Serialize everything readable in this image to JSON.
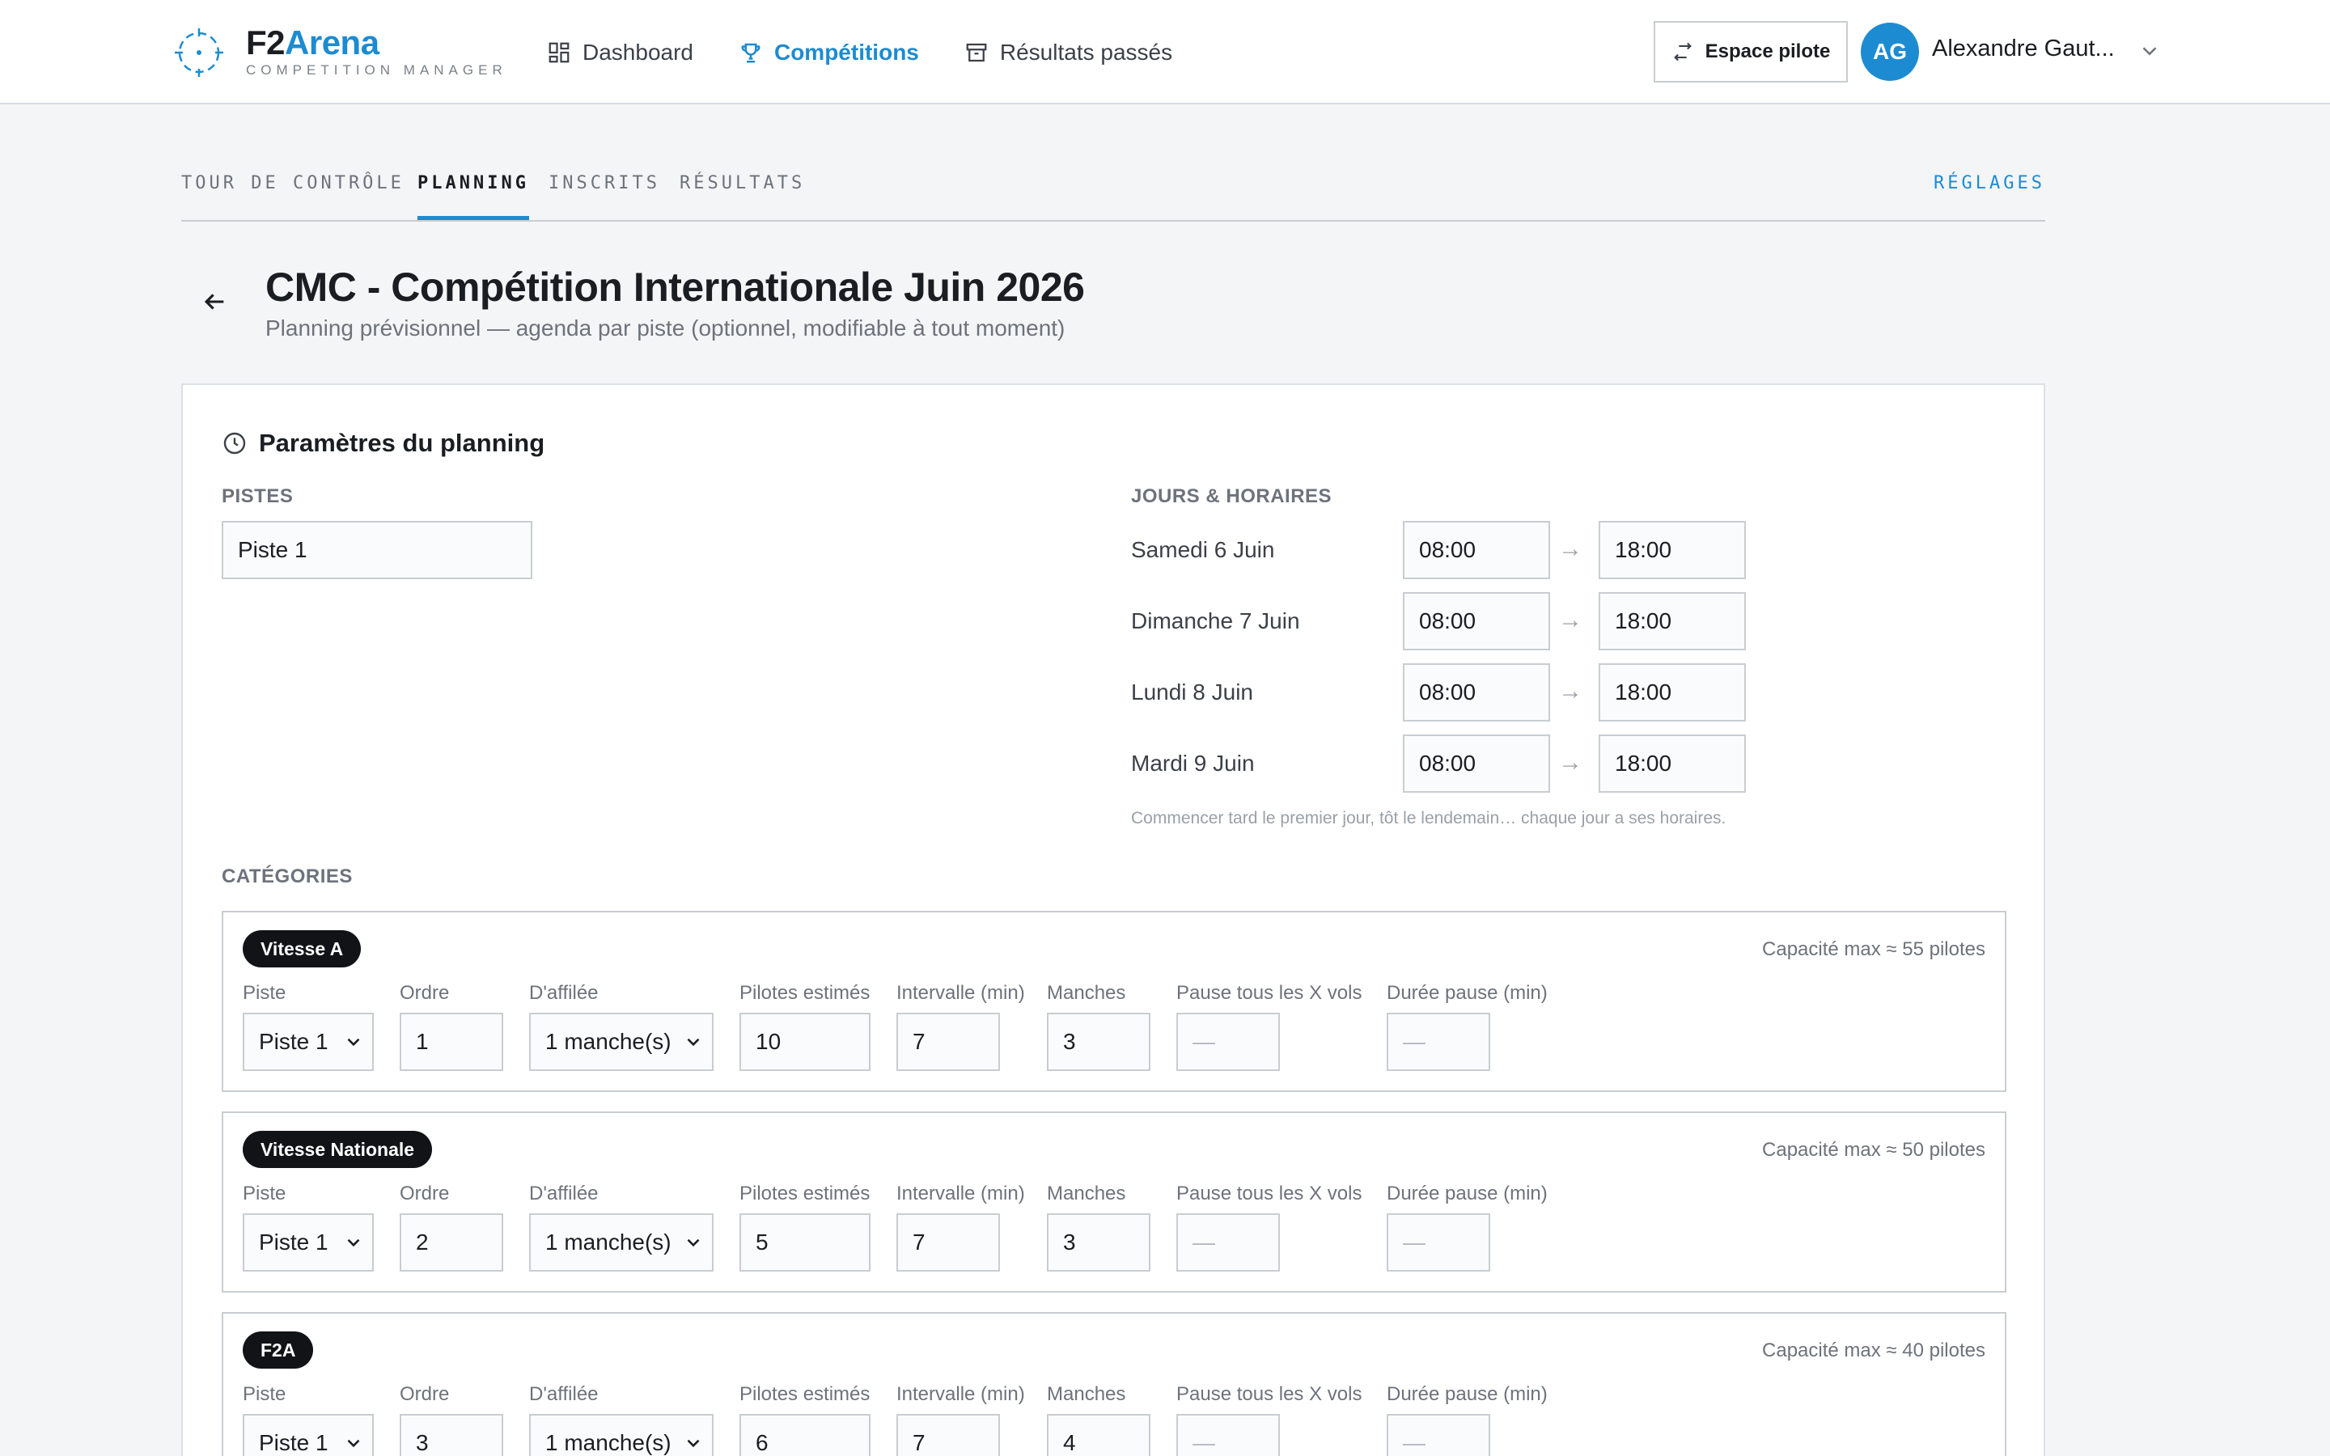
{
  "brand": {
    "name_part1": "F2",
    "name_part2": "Arena",
    "tagline": "COMPETITION MANAGER"
  },
  "nav": {
    "items": [
      {
        "label": "Dashboard",
        "icon": "grid-icon",
        "active": false
      },
      {
        "label": "Compétitions",
        "icon": "trophy-icon",
        "active": true
      },
      {
        "label": "Résultats passés",
        "icon": "archive-icon",
        "active": false
      }
    ],
    "pilot_button": "Espace pilote",
    "user": {
      "initials": "AG",
      "name": "Alexandre Gaut..."
    }
  },
  "subtabs": {
    "items": [
      "TOUR DE CONTRÔLE",
      "PLANNING",
      "INSCRITS",
      "RÉSULTATS"
    ],
    "active": "PLANNING",
    "settings": "RÉGLAGES"
  },
  "page": {
    "title": "CMC - Compétition Internationale Juin 2026",
    "subtitle": "Planning prévisionnel — agenda par piste (optionnel, modifiable à tout moment)"
  },
  "params": {
    "heading": "Paramètres du planning",
    "pistes_label": "PISTES",
    "pistes": [
      "Piste 1"
    ],
    "days_label": "JOURS & HORAIRES",
    "days": [
      {
        "label": "Samedi 6 Juin",
        "start": "08:00",
        "end": "18:00"
      },
      {
        "label": "Dimanche 7 Juin",
        "start": "08:00",
        "end": "18:00"
      },
      {
        "label": "Lundi 8 Juin",
        "start": "08:00",
        "end": "18:00"
      },
      {
        "label": "Mardi 9 Juin",
        "start": "08:00",
        "end": "18:00"
      }
    ],
    "arrow": "→",
    "hint": "Commencer tard le premier jour, tôt le lendemain… chaque jour a ses horaires."
  },
  "categories": {
    "label": "CATÉGORIES",
    "field_labels": {
      "piste": "Piste",
      "ordre": "Ordre",
      "affilee": "D'affilée",
      "pilotes": "Pilotes estimés",
      "intervalle": "Intervalle (min)",
      "manches": "Manches",
      "pause_vols": "Pause tous les X vols",
      "pause_duree": "Durée pause (min)"
    },
    "items": [
      {
        "name": "Vitesse A",
        "capacity": "Capacité max ≈ 55 pilotes",
        "piste": "Piste 1",
        "ordre": "1",
        "affilee": "1 manche(s)",
        "pilotes": "10",
        "intervalle": "7",
        "manches": "3",
        "pause_vols": "—",
        "pause_duree": "—"
      },
      {
        "name": "Vitesse Nationale",
        "capacity": "Capacité max ≈ 50 pilotes",
        "piste": "Piste 1",
        "ordre": "2",
        "affilee": "1 manche(s)",
        "pilotes": "5",
        "intervalle": "7",
        "manches": "3",
        "pause_vols": "—",
        "pause_duree": "—"
      },
      {
        "name": "F2A",
        "capacity": "Capacité max ≈ 40 pilotes",
        "piste": "Piste 1",
        "ordre": "3",
        "affilee": "1 manche(s)",
        "pilotes": "6",
        "intervalle": "7",
        "manches": "4",
        "pause_vols": "—",
        "pause_duree": "—"
      }
    ]
  },
  "colors": {
    "accent": "#1d8bd1",
    "badge": "#111316",
    "background": "#f4f5f7"
  }
}
